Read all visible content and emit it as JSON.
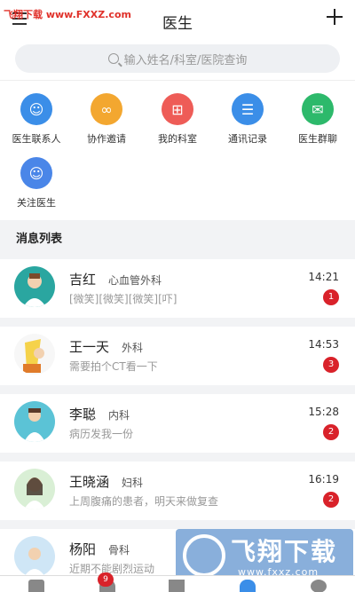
{
  "watermark_top": "飞翔下载 www.FXXZ.com",
  "header": {
    "title": "医生"
  },
  "search": {
    "placeholder": "输入姓名/科室/医院查询"
  },
  "quick_actions": [
    {
      "label": "医生联系人",
      "color": "#3b8ee8",
      "icon": "person-icon"
    },
    {
      "label": "协作邀请",
      "color": "#f3a730",
      "icon": "handshake-icon"
    },
    {
      "label": "我的科室",
      "color": "#ee5c57",
      "icon": "plus-square-icon"
    },
    {
      "label": "通讯记录",
      "color": "#3b8ee8",
      "icon": "list-icon"
    },
    {
      "label": "医生群聊",
      "color": "#2db96b",
      "icon": "chat-icon"
    },
    {
      "label": "关注医生",
      "color": "#4a86e8",
      "icon": "person-icon"
    }
  ],
  "section_title": "消息列表",
  "messages": [
    {
      "name": "吉红",
      "dept": "心血管外科",
      "msg": "[微笑][微笑][微笑][吓]",
      "time": "14:21",
      "badge": "1"
    },
    {
      "name": "王一天",
      "dept": "外科",
      "msg": "需要拍个CT看一下",
      "time": "14:53",
      "badge": "3"
    },
    {
      "name": "李聪",
      "dept": "内科",
      "msg": "病历发我一份",
      "time": "15:28",
      "badge": "2"
    },
    {
      "name": "王晓涵",
      "dept": "妇科",
      "msg": "上周腹痛的患者，明天来做复查",
      "time": "16:19",
      "badge": "2"
    },
    {
      "name": "杨阳",
      "dept": "骨科",
      "msg": "近期不能剧烈运动",
      "time": "",
      "badge": ""
    }
  ],
  "tabbar": {
    "badge": "9"
  },
  "watermark_bottom": {
    "text": "飞翔下载",
    "url": "www.fxxz.com"
  }
}
